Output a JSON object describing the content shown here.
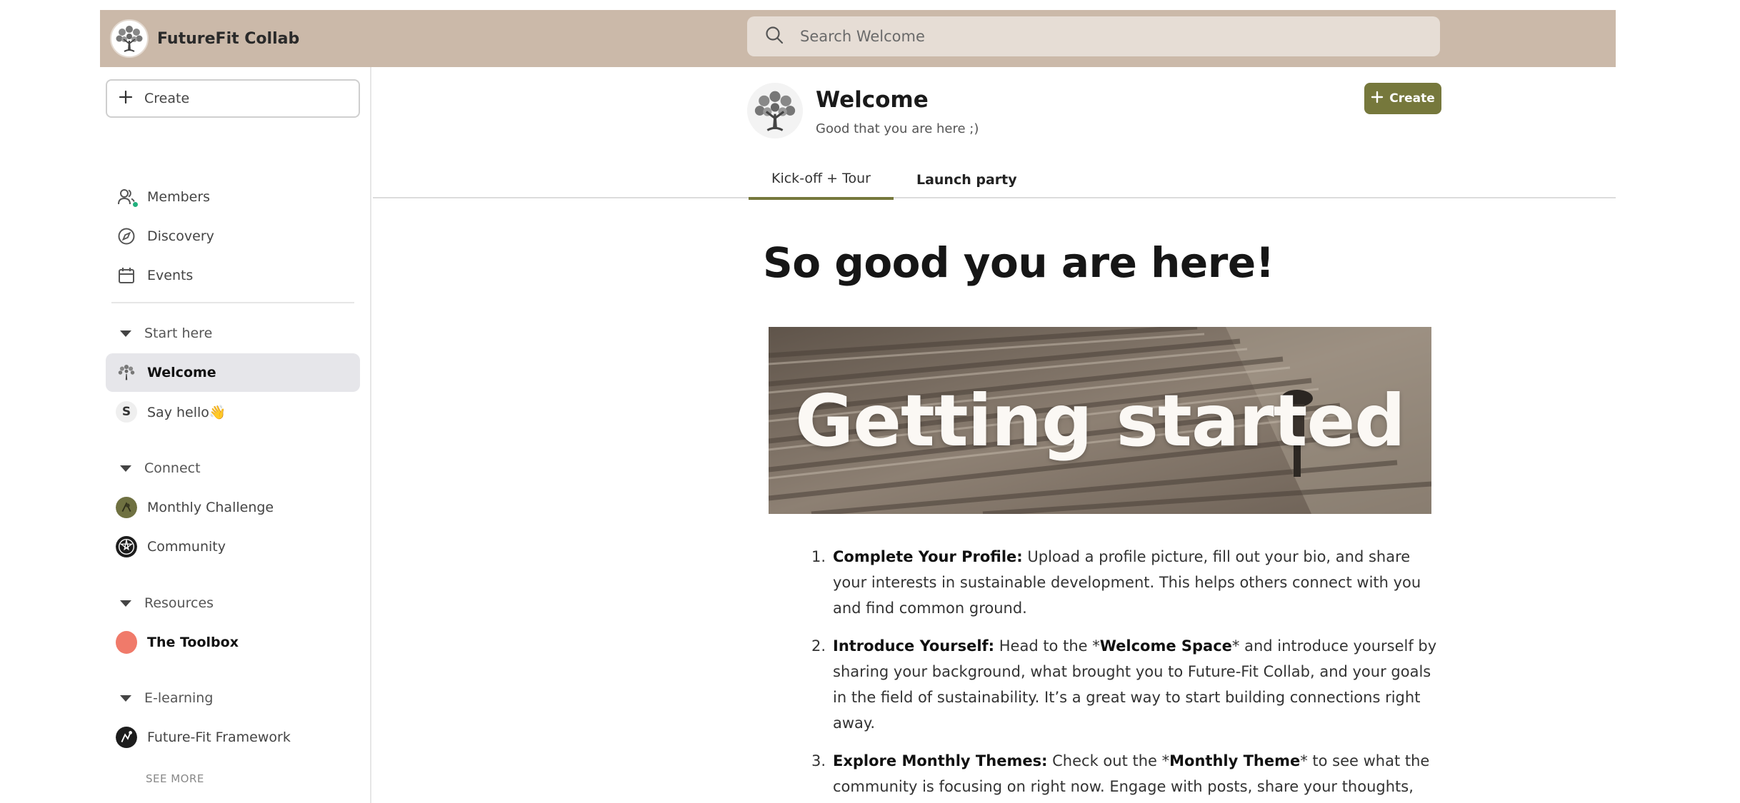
{
  "app": {
    "name": "FutureFit Collab"
  },
  "search": {
    "placeholder": "Search Welcome"
  },
  "sidebar": {
    "create_label": "Create",
    "nav": [
      "Members",
      "Discovery",
      "Events"
    ],
    "sections": [
      {
        "title": "Start here",
        "items": [
          "Welcome",
          "Say hello👋"
        ]
      },
      {
        "title": "Connect",
        "items": [
          "Monthly Challenge",
          "Community"
        ]
      },
      {
        "title": "Resources",
        "items": [
          "The Toolbox"
        ]
      },
      {
        "title": "E-learning",
        "items": [
          "Future-Fit Framework"
        ]
      }
    ],
    "see_more": "SEE MORE",
    "active_item": "Welcome"
  },
  "space": {
    "title": "Welcome",
    "subtitle": "Good that you are here ;)",
    "create_label": "Create",
    "tabs": [
      "Kick-off + Tour",
      "Launch party"
    ],
    "active_tab": "Kick-off + Tour"
  },
  "content": {
    "heading": "So good you are here!",
    "banner_text": "Getting started",
    "steps": [
      {
        "number": "1.",
        "title": "Complete Your Profile:",
        "text": " Upload a profile picture, fill out your bio, and share your interests in sustainable development. This helps others connect with you and find common ground."
      },
      {
        "number": "2.",
        "title": "Introduce Yourself:",
        "text_a": " Head to the *",
        "strong": "Welcome Space",
        "text_b": "* and introduce yourself by sharing your background, what brought you to Future-Fit Collab, and your goals in the field of sustainability. It’s a great way to start building connections right away."
      },
      {
        "number": "3.",
        "title": "Explore Monthly Themes:",
        "text_a": " Check out the *",
        "strong": "Monthly Theme",
        "text_b": "* to see what the community is focusing on right now. Engage with posts, share your thoughts,"
      }
    ]
  },
  "colors": {
    "topbar": "#cbb9a9",
    "search": "#e6ddd5",
    "accent": "#76783c",
    "active_item_bg": "#e6e6ea",
    "toolbox_avatar": "#f07a6a",
    "online_dot": "#22b07d"
  },
  "icons": {
    "search": "search-icon",
    "plus": "plus-icon",
    "members": "members-icon",
    "discovery": "compass-icon",
    "events": "calendar-icon",
    "collapse": "caret-down-icon"
  }
}
